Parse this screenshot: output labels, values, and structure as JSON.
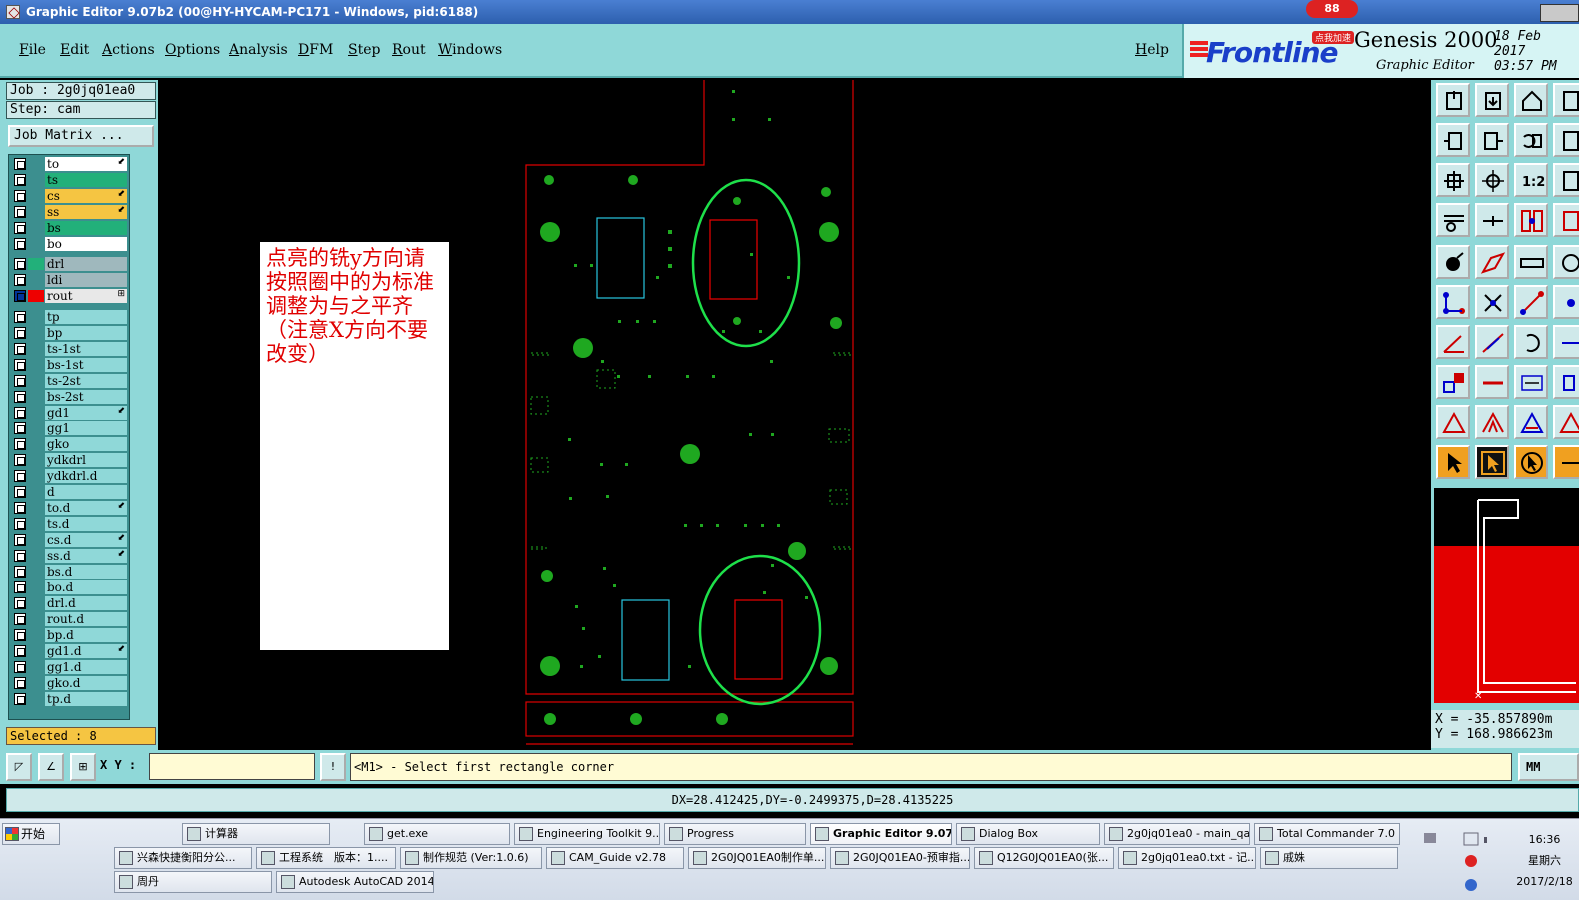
{
  "window": {
    "title": "Graphic Editor 9.07b2 (00@HY-HYCAM-PC171 - Windows, pid:6188)"
  },
  "menu": {
    "file": "File",
    "edit": "Edit",
    "actions": "Actions",
    "options": "Options",
    "analysis": "Analysis",
    "dfm": "DFM",
    "step": "Step",
    "rout": "Rout",
    "windows": "Windows",
    "help": "Help"
  },
  "brand": {
    "logo": "Frontline",
    "product": "Genesis 2000",
    "subtitle": "Graphic Editor",
    "date": "18 Feb 2017",
    "time": "03:57 PM",
    "badge": "88",
    "badge_text": "点我加速"
  },
  "job": {
    "job_label": "Job : 2g0jq01ea0",
    "step_label": "Step: cam",
    "matrix_button": "Job Matrix ...",
    "selected": "Selected : 8"
  },
  "layers": [
    {
      "name": "to",
      "color": "#ffffff",
      "mark": "⬋"
    },
    {
      "name": "ts",
      "color": "#22b07a",
      "mark": ""
    },
    {
      "name": "cs",
      "color": "#f5c542",
      "mark": "⬋"
    },
    {
      "name": "ss",
      "color": "#f5c542",
      "mark": "⬋"
    },
    {
      "name": "bs",
      "color": "#22b07a",
      "mark": ""
    },
    {
      "name": "bo",
      "color": "#ffffff",
      "mark": ""
    },
    {
      "name": "drl",
      "color": "#9fb8bd",
      "mark": ""
    },
    {
      "name": "ldi",
      "color": "#9fb8bd",
      "mark": ""
    },
    {
      "name": "rout",
      "color": "#e8e8e8",
      "mark": "⊞"
    },
    {
      "name": "tp",
      "color": "#8fd8d8",
      "mark": ""
    },
    {
      "name": "bp",
      "color": "#8fd8d8",
      "mark": ""
    },
    {
      "name": "ts-1st",
      "color": "#8fd8d8",
      "mark": ""
    },
    {
      "name": "bs-1st",
      "color": "#8fd8d8",
      "mark": ""
    },
    {
      "name": "ts-2st",
      "color": "#8fd8d8",
      "mark": ""
    },
    {
      "name": "bs-2st",
      "color": "#8fd8d8",
      "mark": ""
    },
    {
      "name": "gd1",
      "color": "#8fd8d8",
      "mark": "⬋"
    },
    {
      "name": "gg1",
      "color": "#8fd8d8",
      "mark": ""
    },
    {
      "name": "gko",
      "color": "#8fd8d8",
      "mark": ""
    },
    {
      "name": "ydkdrl",
      "color": "#8fd8d8",
      "mark": ""
    },
    {
      "name": "ydkdrl.d",
      "color": "#8fd8d8",
      "mark": ""
    },
    {
      "name": "d",
      "color": "#8fd8d8",
      "mark": ""
    },
    {
      "name": "to.d",
      "color": "#8fd8d8",
      "mark": "⬋"
    },
    {
      "name": "ts.d",
      "color": "#8fd8d8",
      "mark": ""
    },
    {
      "name": "cs.d",
      "color": "#8fd8d8",
      "mark": "⬋"
    },
    {
      "name": "ss.d",
      "color": "#8fd8d8",
      "mark": "⬋"
    },
    {
      "name": "bs.d",
      "color": "#8fd8d8",
      "mark": ""
    },
    {
      "name": "bo.d",
      "color": "#8fd8d8",
      "mark": ""
    },
    {
      "name": "drl.d",
      "color": "#8fd8d8",
      "mark": ""
    },
    {
      "name": "rout.d",
      "color": "#8fd8d8",
      "mark": ""
    },
    {
      "name": "bp.d",
      "color": "#8fd8d8",
      "mark": ""
    },
    {
      "name": "gd1.d",
      "color": "#8fd8d8",
      "mark": "⬋"
    },
    {
      "name": "gg1.d",
      "color": "#8fd8d8",
      "mark": ""
    },
    {
      "name": "gko.d",
      "color": "#8fd8d8",
      "mark": ""
    },
    {
      "name": "tp.d",
      "color": "#8fd8d8",
      "mark": ""
    }
  ],
  "annotation": {
    "text": "点亮的铣y方向请按照圈中的为标准 调整为与之平齐（注意X方向不要改变）"
  },
  "coords": {
    "x": "X = -35.857890m",
    "y": "Y = 168.986623m"
  },
  "command": {
    "xy_label": "X Y :",
    "xy_value": "",
    "prompt": "<M1> - Select first rectangle corner",
    "unit": "MM"
  },
  "status": {
    "measure": "DX=28.412425,DY=-0.2499375,D=28.4135225"
  },
  "tools": [
    "home-icon",
    "pan-icon",
    "zoom-icon",
    "fit-icon",
    "scale-icon",
    "measure-icon",
    "highlight-icon",
    "snap-icon"
  ],
  "taskbar": {
    "start": "开始",
    "row1": [
      "计算器",
      "get.exe",
      "Engineering Toolkit 9....",
      "Progress",
      "Graphic Editor 9.07...",
      "Dialog Box",
      "2g0jq01ea0 - main_qa",
      "Total Commander 7.0 ..."
    ],
    "row2": [
      "兴森快捷衡阳分公...",
      "工程系统　版本：1....",
      "制作规范 (Ver:1.0.6)",
      "CAM_Guide v2.78",
      "2G0JQ01EA0制作单...",
      "2G0JQ01EA0-预审指...",
      "Q12G0JQ01EA0(张...",
      "2g0jq01ea0.txt - 记...",
      "戚姝"
    ],
    "row3": [
      "周丹",
      "Autodesk AutoCAD 2014..."
    ],
    "time": "16:36",
    "weekday": "星期六",
    "date": "2017/2/18"
  }
}
